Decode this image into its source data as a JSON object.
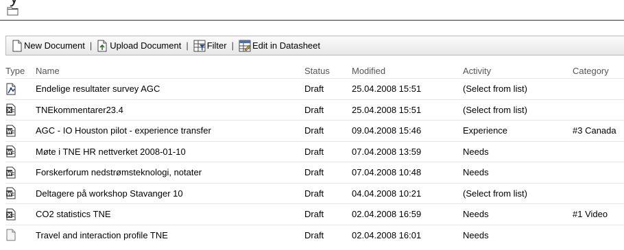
{
  "page": {
    "title_fragment": "y"
  },
  "toolbar": {
    "new_document": "New Document",
    "upload_document": "Upload Document",
    "filter": "Filter",
    "edit_in_datasheet": "Edit in Datasheet",
    "separator": "|"
  },
  "columns": {
    "type": "Type",
    "name": "Name",
    "status": "Status",
    "modified": "Modified",
    "activity": "Activity",
    "category": "Category"
  },
  "rows": [
    {
      "icon": "survey-doc-icon",
      "name": "Endelige resultater survey AGC",
      "status": "Draft",
      "modified": "25.04.2008 15:51",
      "activity": "(Select from list)",
      "category": ""
    },
    {
      "icon": "excel-doc-icon",
      "name": "TNEkommentarer23.4",
      "status": "Draft",
      "modified": "25.04.2008 15:51",
      "activity": "(Select from list)",
      "category": ""
    },
    {
      "icon": "word-doc-icon",
      "name": "AGC - IO Houston pilot - experience transfer",
      "status": "Draft",
      "modified": "09.04.2008 15:46",
      "activity": "Experience",
      "category": "#3 Canada"
    },
    {
      "icon": "word-doc-icon",
      "name": "Møte i TNE HR nettverket 2008-01-10",
      "status": "Draft",
      "modified": "07.04.2008 13:59",
      "activity": "Needs",
      "category": ""
    },
    {
      "icon": "word-doc-icon",
      "name": "Forskerforum nedstrømsteknologi, notater",
      "status": "Draft",
      "modified": "07.04.2008 10:48",
      "activity": "Needs",
      "category": ""
    },
    {
      "icon": "word-doc-icon",
      "name": "Deltagere på workshop Stavanger 10",
      "status": "Draft",
      "modified": "04.04.2008 10:21",
      "activity": "(Select from list)",
      "category": ""
    },
    {
      "icon": "excel-doc-icon",
      "name": "CO2 statistics TNE",
      "status": "Draft",
      "modified": "02.04.2008 16:59",
      "activity": "Needs",
      "category": "#1 Video"
    },
    {
      "icon": "generic-doc-icon",
      "name": "Travel and interaction profile TNE",
      "status": "Draft",
      "modified": "02.04.2008 16:01",
      "activity": "Needs",
      "category": ""
    }
  ]
}
